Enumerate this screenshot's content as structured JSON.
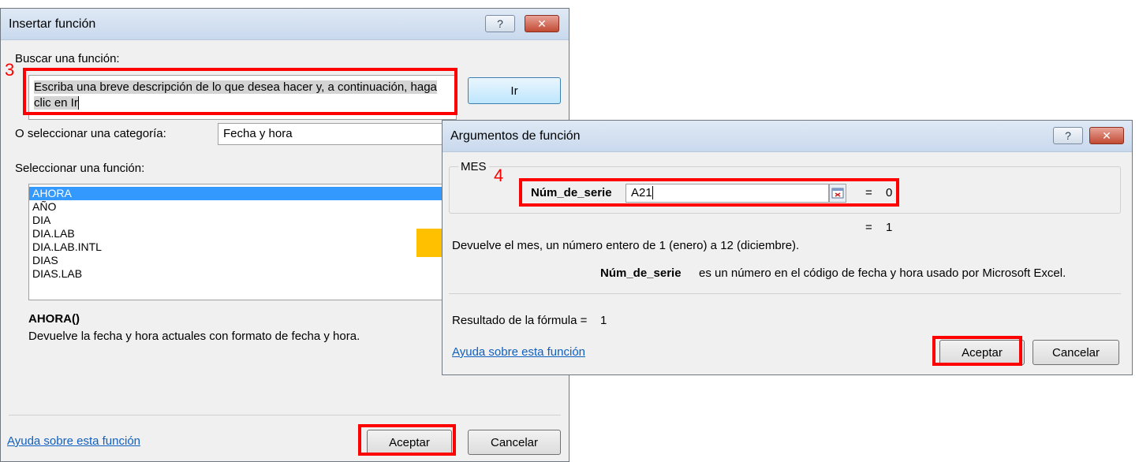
{
  "dialog1": {
    "title": "Insertar función",
    "help_btn": "?",
    "close_btn": "✕",
    "search_label": "Buscar una función:",
    "search_text": "Escriba una breve descripción de lo que desea hacer y, a continuación, haga clic en Ir",
    "go_button": "Ir",
    "category_label": "O seleccionar una categoría:",
    "category_value": "Fecha y hora",
    "function_list_label": "Seleccionar una función:",
    "functions": [
      "AHORA",
      "AÑO",
      "DIA",
      "DIA.LAB",
      "DIA.LAB.INTL",
      "DIAS",
      "DIAS.LAB"
    ],
    "selected_signature": "AHORA()",
    "selected_description": "Devuelve la fecha y hora actuales con formato de fecha y hora.",
    "help_link": "Ayuda sobre esta función",
    "ok_button": "Aceptar",
    "cancel_button": "Cancelar"
  },
  "dialog2": {
    "title": "Argumentos de función",
    "help_btn": "?",
    "close_btn": "✕",
    "function_name": "MES",
    "arg_name": "Núm_de_serie",
    "arg_value": "A21",
    "arg_equals": "=",
    "arg_result": "0",
    "func_equals": "=",
    "func_result": "1",
    "description": "Devuelve el mes, un número entero de 1 (enero) a 12 (diciembre).",
    "arg_help_name": "Núm_de_serie",
    "arg_help_text": "es un número en el código de fecha y hora usado por Microsoft Excel.",
    "formula_result_label": "Resultado de la fórmula =",
    "formula_result_value": "1",
    "help_link": "Ayuda sobre esta función",
    "ok_button": "Aceptar",
    "cancel_button": "Cancelar"
  },
  "annotations": {
    "step3": "3",
    "step4": "4"
  },
  "colors": {
    "annotation_red": "#ff0000",
    "arrow_yellow": "#ffc000",
    "selection_blue": "#3399ff",
    "link_blue": "#1060c0"
  }
}
